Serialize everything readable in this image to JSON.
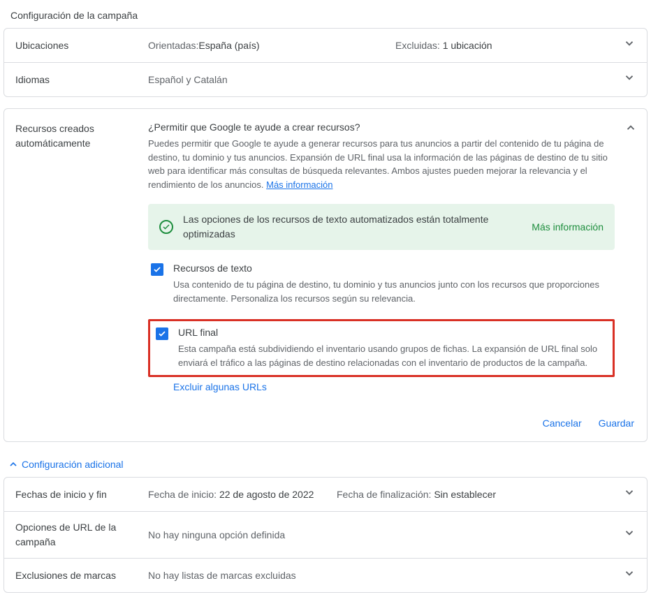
{
  "sectionTitle": "Configuración de la campaña",
  "locations": {
    "label": "Ubicaciones",
    "oriPrefix": "Orientadas: ",
    "oriValue": "España (país)",
    "exPrefix": "Excluidas: ",
    "exValue": "1 ubicación"
  },
  "languages": {
    "label": "Idiomas",
    "value": "Español y Catalán"
  },
  "autoAssets": {
    "label": "Recursos creados automáticamente",
    "title": "¿Permitir que Google te ayude a crear recursos?",
    "desc": "Puedes permitir que Google te ayude a generar recursos para tus anuncios a partir del contenido de tu página de destino, tu dominio y tus anuncios. Expansión de URL final usa la información de las páginas de destino de tu sitio web para identificar más consultas de búsqueda relevantes. Ambos ajustes pueden mejorar la relevancia y el rendimiento de los anuncios. ",
    "moreInfo": "Más información",
    "greenBox": {
      "text": "Las opciones de los recursos de texto automatizados están totalmente optimizadas",
      "link": "Más información"
    },
    "textAssets": {
      "label": "Recursos de texto",
      "desc": "Usa contenido de tu página de destino, tu dominio y tus anuncios junto con los recursos que proporciones directamente. Personaliza los recursos según su relevancia."
    },
    "finalUrl": {
      "label": "URL final",
      "desc": "Esta campaña está subdividiendo el inventario usando grupos de fichas. La expansión de URL final solo enviará el tráfico a las páginas de destino relacionadas con el inventario de productos de la campaña."
    },
    "excludeLink": "Excluir algunas URLs",
    "cancel": "Cancelar",
    "save": "Guardar"
  },
  "additionalConfig": "Configuración adicional",
  "dates": {
    "label": "Fechas de inicio y fin",
    "startPrefix": "Fecha de inicio: ",
    "startValue": "22 de agosto de 2022",
    "endPrefix": "Fecha de finalización: ",
    "endValue": "Sin establecer"
  },
  "urlOptions": {
    "label": "Opciones de URL de la campaña",
    "value": "No hay ninguna opción definida"
  },
  "brandExclusions": {
    "label": "Exclusiones de marcas",
    "value": "No hay listas de marcas excluidas"
  }
}
